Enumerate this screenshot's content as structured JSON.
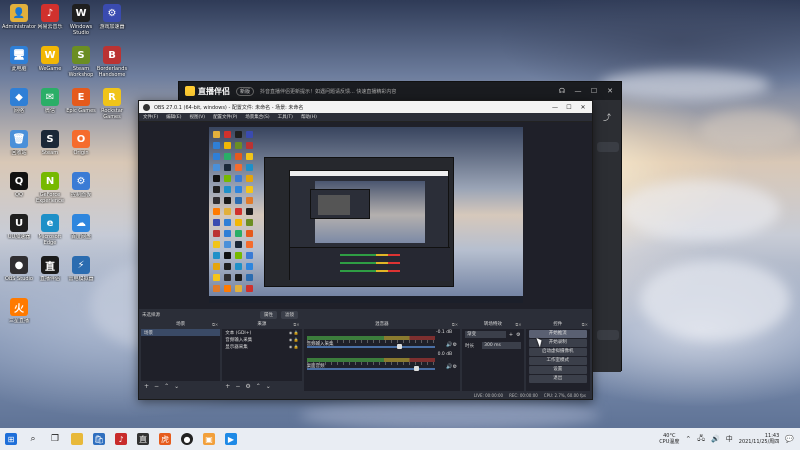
{
  "desktop": {
    "icons": [
      {
        "label": "Administrator",
        "color": "#e2b03c",
        "glyph": "👤"
      },
      {
        "label": "网易云音乐",
        "color": "#d0312d",
        "glyph": "♪"
      },
      {
        "label": "Windows Studio",
        "color": "#1f1f1f",
        "glyph": "W"
      },
      {
        "label": "游戏加速器",
        "color": "#3a4bb0",
        "glyph": "⚙"
      },
      {
        "label": "此电脑",
        "color": "#2f7fd6",
        "glyph": "🖥"
      },
      {
        "label": "WeGame",
        "color": "#f2b705",
        "glyph": "W"
      },
      {
        "label": "Steam Workshop",
        "color": "#6b8e23",
        "glyph": "S"
      },
      {
        "label": "Borderlands Handsome",
        "color": "#b33",
        "glyph": "B"
      },
      {
        "label": "网络",
        "color": "#2f7fd6",
        "glyph": "◆"
      },
      {
        "label": "微信",
        "color": "#2aae67",
        "glyph": "✉"
      },
      {
        "label": "Epic Games",
        "color": "#e55a1c",
        "glyph": "E"
      },
      {
        "label": "Rockstar Games",
        "color": "#f0c419",
        "glyph": "R"
      },
      {
        "label": "回收站",
        "color": "#4a90d9",
        "glyph": "🗑"
      },
      {
        "label": "Steam",
        "color": "#1b2838",
        "glyph": "S"
      },
      {
        "label": "Origin",
        "color": "#f56c2d",
        "glyph": "O"
      },
      {
        "label": "Microsoft Edge",
        "color": "#1e90c8",
        "glyph": "e"
      },
      {
        "label": "QQ",
        "color": "#111",
        "glyph": "Q"
      },
      {
        "label": "GeForce Experience",
        "color": "#76b900",
        "glyph": "N"
      },
      {
        "label": "控制面板",
        "color": "#3a7bd5",
        "glyph": "⚙"
      },
      {
        "label": "Counter-Strike Global",
        "color": "#e5a50a",
        "glyph": "G"
      },
      {
        "label": "UU加速器",
        "color": "#1f1f1f",
        "glyph": "U"
      },
      {
        "label": "Microsoft Edge",
        "color": "#1e90c8",
        "glyph": "e"
      },
      {
        "label": "百度网盘",
        "color": "#2e86de",
        "glyph": "☁"
      },
      {
        "label": "QQ音乐",
        "color": "#f5c518",
        "glyph": "♫"
      },
      {
        "label": "OBS Studio",
        "color": "#302e31",
        "glyph": "●"
      },
      {
        "label": "直播伴侣",
        "color": "#1a1a1a",
        "glyph": "直"
      },
      {
        "label": "雷电模拟器",
        "color": "#2b6cb0",
        "glyph": "⚡"
      },
      {
        "label": "火狐直播",
        "color": "#e07b2a",
        "glyph": "🔥"
      },
      {
        "label": "三星直播",
        "color": "#ff7a00",
        "glyph": "火"
      }
    ]
  },
  "bg_app": {
    "brand": "直播伴侣",
    "version": "新版",
    "notice": "抖音直播伴侣更新提示！如遇问题请反馈...  快速直播精彩内容"
  },
  "obs": {
    "title": "OBS 27.0.1 (64-bit, windows) - 配置文件: 未命名 - 场景: 未命名",
    "menu": [
      "文件(F)",
      "编辑(E)",
      "视图(V)",
      "配置文件(P)",
      "场景集合(S)",
      "工具(T)",
      "帮助(H)"
    ],
    "source_bar": {
      "label": "未选择源",
      "props": "属性",
      "filters": "滤镜"
    },
    "docks": {
      "scenes": {
        "title": "场景",
        "items": [
          "场景"
        ]
      },
      "sources": {
        "title": "来源",
        "items": [
          "文本 (GDI+)",
          "音频输入采集",
          "显示器采集"
        ]
      },
      "mixer": {
        "title": "混音器",
        "channels": [
          {
            "name": "音频输入采集",
            "db": "-0.1 dB",
            "level": 0.72
          },
          {
            "name": "桌面音频",
            "db": "0.0 dB",
            "level": 0.86
          }
        ]
      },
      "transitions": {
        "title": "转场特效",
        "type_label": "渐变",
        "duration_label": "时长",
        "duration": "300 ms"
      },
      "controls": {
        "title": "控件",
        "buttons": [
          "开始推流",
          "开始录制",
          "启动虚拟摄像机",
          "工作室模式",
          "设置",
          "退出"
        ]
      }
    },
    "status": {
      "live": "LIVE: 00:00:00",
      "rec": "REC: 00:00:00",
      "cpu": "CPU: 2.7%, 60.00 fps"
    }
  },
  "taskbar": {
    "weather": {
      "temp": "40°C",
      "desc": "CPU温度"
    },
    "time": "11:43",
    "date": "2021/11/25/周四",
    "lang": "中"
  }
}
